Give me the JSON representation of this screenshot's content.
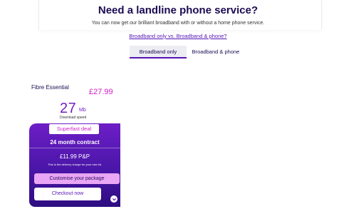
{
  "header": {
    "title": "Need a landline phone service?",
    "subtitle": "You can now get our brilliant broadband with or without a home phone service.",
    "compare_link": "Broadband only vs. Broadband & phone?"
  },
  "tabs": [
    {
      "label": "Broadband only",
      "active": true
    },
    {
      "label": "Broadband & phone",
      "active": false
    }
  ],
  "plan": {
    "name": "Fibre Essential",
    "price": "£27.99",
    "speed_value": "27",
    "speed_unit": "Mb",
    "speed_label": "Download speed",
    "deal_badge": "Superfast deal",
    "contract": "24 month contract",
    "pnp": "£11.99 P&P",
    "pnp_note": "This is the delivery charge for your new kit.",
    "customise_label": "Customise your package",
    "checkout_label": "Checkout now"
  },
  "colors": {
    "brand_purple": "#5514b4",
    "accent_pink": "#d01ec8",
    "customise_bg": "#e9a6f5"
  },
  "icons": {
    "expand": "chevron-down-icon"
  }
}
